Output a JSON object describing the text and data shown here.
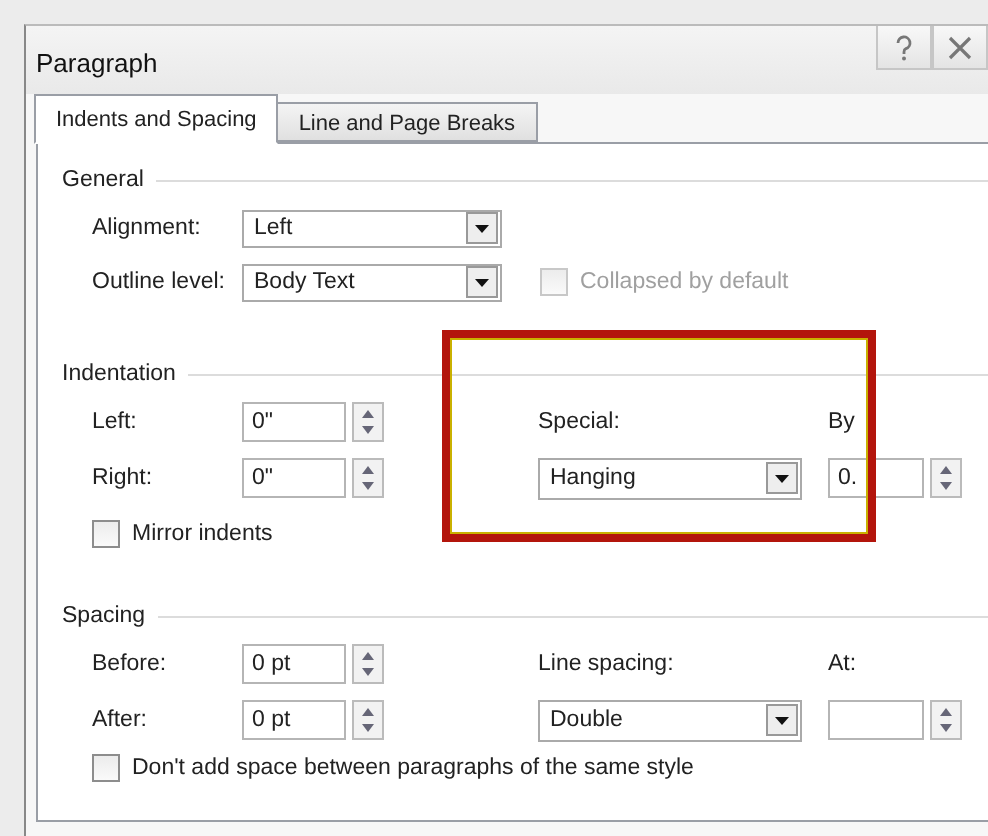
{
  "window": {
    "title": "Paragraph"
  },
  "tabs": [
    {
      "label": "Indents and Spacing",
      "selected": true
    },
    {
      "label": "Line and Page Breaks",
      "selected": false
    }
  ],
  "general": {
    "heading": "General",
    "alignment": {
      "label": "Alignment:",
      "value": "Left"
    },
    "outline_level": {
      "label": "Outline level:",
      "value": "Body Text"
    },
    "collapsed": {
      "label": "Collapsed by default",
      "checked": false,
      "disabled": true
    }
  },
  "indentation": {
    "heading": "Indentation",
    "left": {
      "label": "Left:",
      "value": "0\""
    },
    "right": {
      "label": "Right:",
      "value": "0\""
    },
    "special": {
      "label": "Special:",
      "value": "Hanging"
    },
    "by": {
      "label": "By",
      "value": "0."
    },
    "mirror": {
      "label": "Mirror indents",
      "checked": false
    }
  },
  "spacing": {
    "heading": "Spacing",
    "before": {
      "label": "Before:",
      "value": "0 pt"
    },
    "after": {
      "label": "After:",
      "value": "0 pt"
    },
    "line_spacing": {
      "label": "Line spacing:",
      "value": "Double"
    },
    "at": {
      "label": "At:"
    },
    "dont_add": {
      "label": "Don't add space between paragraphs of the same style",
      "checked": false
    }
  }
}
